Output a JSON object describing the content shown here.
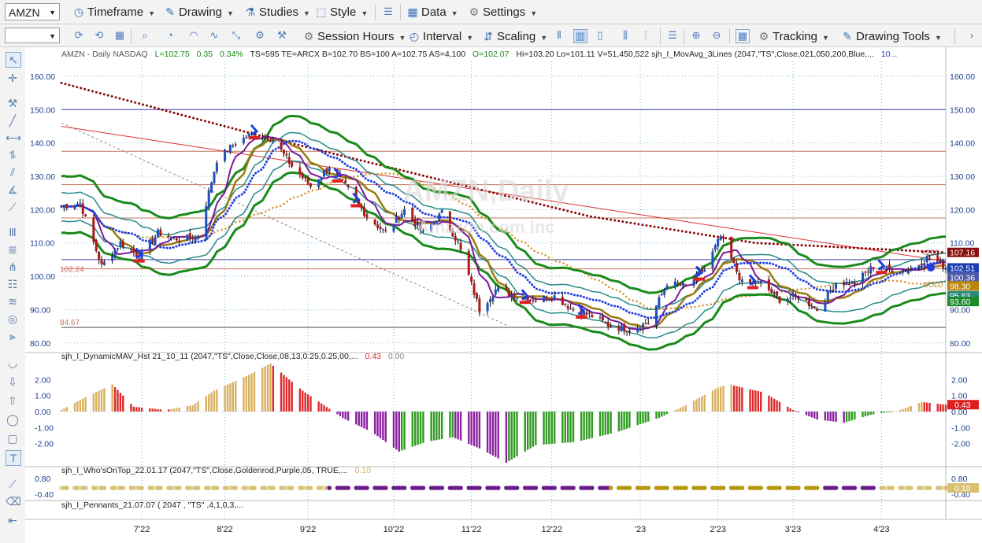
{
  "toolbar1": {
    "symbol": "AMZN",
    "items": [
      {
        "label": "Timeframe",
        "icon": "clock-icon"
      },
      {
        "label": "Drawing",
        "icon": "pencil-icon"
      },
      {
        "label": "Studies",
        "icon": "flask-icon"
      },
      {
        "label": "Style",
        "icon": "style-icon"
      },
      {
        "label": "Data",
        "icon": "data-icon"
      },
      {
        "label": "Settings",
        "icon": "gear-icon"
      }
    ]
  },
  "toolbar2": {
    "items": [
      {
        "label": "Session Hours",
        "icon": "gear-icon"
      },
      {
        "label": "Interval",
        "icon": "interval-icon"
      },
      {
        "label": "Scaling",
        "icon": "scaling-icon"
      },
      {
        "label": "Tracking",
        "icon": "tracking-icon"
      },
      {
        "label": "Drawing Tools",
        "icon": "drawing-tools-icon"
      }
    ]
  },
  "header": {
    "prefix": "AMZN - Daily  NASDAQ",
    "last": "L=102.75",
    "change": "0.35",
    "pct": "0.34%",
    "stats": "TS=595  TE=ARCX  B=102.70  BS=100  A=102.75  AS=4,100",
    "open": "O=102.07",
    "rest": "Hi=103.20  Lo=101.11  V=51,450,522  sjh_I_MovAvg_3Lines (2047,\"TS\",Close,021,050,200,Blue,...",
    "trail": "10..."
  },
  "watermark": {
    "line1": "AMZN,Daily",
    "line2": "Amazon.com Inc"
  },
  "chart_data": [
    {
      "type": "candlestick",
      "title": "AMZN - Daily  NASDAQ",
      "y_ticks": [
        "160.00",
        "150.00",
        "140.00",
        "130.00",
        "120.00",
        "110.00",
        "100.00",
        "90.00",
        "80.00"
      ],
      "ylim": [
        79,
        164
      ],
      "x_ticks": [
        "7'22",
        "8'22",
        "9'22",
        "10'22",
        "11'22",
        "12'22",
        "'23",
        "2'23",
        "3'23",
        "4'23"
      ],
      "x_domain": [
        "2022-06-01",
        "2023-04-27"
      ],
      "tick_dates": [
        "2022-07-01",
        "2022-08-01",
        "2022-09-01",
        "2022-10-03",
        "2022-11-01",
        "2022-12-01",
        "2023-01-03",
        "2023-02-01",
        "2023-03-01",
        "2023-04-03"
      ],
      "close_path": [
        {
          "d": "2022-06-01",
          "v": 121
        },
        {
          "d": "2022-06-08",
          "v": 122
        },
        {
          "d": "2022-06-16",
          "v": 103
        },
        {
          "d": "2022-06-23",
          "v": 110
        },
        {
          "d": "2022-06-30",
          "v": 106
        },
        {
          "d": "2022-07-07",
          "v": 113
        },
        {
          "d": "2022-07-15",
          "v": 111
        },
        {
          "d": "2022-07-22",
          "v": 112
        },
        {
          "d": "2022-07-29",
          "v": 135
        },
        {
          "d": "2022-08-05",
          "v": 140
        },
        {
          "d": "2022-08-12",
          "v": 143
        },
        {
          "d": "2022-08-19",
          "v": 141
        },
        {
          "d": "2022-08-26",
          "v": 133
        },
        {
          "d": "2022-09-02",
          "v": 127
        },
        {
          "d": "2022-09-09",
          "v": 133
        },
        {
          "d": "2022-09-16",
          "v": 126
        },
        {
          "d": "2022-09-23",
          "v": 118
        },
        {
          "d": "2022-09-30",
          "v": 113
        },
        {
          "d": "2022-10-07",
          "v": 120
        },
        {
          "d": "2022-10-14",
          "v": 113
        },
        {
          "d": "2022-10-21",
          "v": 119
        },
        {
          "d": "2022-10-27",
          "v": 110
        },
        {
          "d": "2022-11-04",
          "v": 90
        },
        {
          "d": "2022-11-10",
          "v": 96
        },
        {
          "d": "2022-11-18",
          "v": 94
        },
        {
          "d": "2022-11-25",
          "v": 93
        },
        {
          "d": "2022-12-02",
          "v": 94
        },
        {
          "d": "2022-12-09",
          "v": 90
        },
        {
          "d": "2022-12-16",
          "v": 88
        },
        {
          "d": "2022-12-23",
          "v": 85
        },
        {
          "d": "2022-12-30",
          "v": 84
        },
        {
          "d": "2023-01-06",
          "v": 86
        },
        {
          "d": "2023-01-13",
          "v": 98
        },
        {
          "d": "2023-01-20",
          "v": 97
        },
        {
          "d": "2023-01-27",
          "v": 102
        },
        {
          "d": "2023-02-02",
          "v": 112
        },
        {
          "d": "2023-02-10",
          "v": 98
        },
        {
          "d": "2023-02-17",
          "v": 98
        },
        {
          "d": "2023-02-24",
          "v": 93
        },
        {
          "d": "2023-03-03",
          "v": 94
        },
        {
          "d": "2023-03-10",
          "v": 90
        },
        {
          "d": "2023-03-17",
          "v": 98
        },
        {
          "d": "2023-03-24",
          "v": 98
        },
        {
          "d": "2023-03-31",
          "v": 103
        },
        {
          "d": "2023-04-07",
          "v": 102
        },
        {
          "d": "2023-04-14",
          "v": 102
        },
        {
          "d": "2023-04-21",
          "v": 106
        },
        {
          "d": "2023-04-27",
          "v": 102.75
        }
      ],
      "ma200": [
        {
          "d": "2022-06-01",
          "v": 158
        },
        {
          "d": "2022-08-15",
          "v": 142
        },
        {
          "d": "2022-10-15",
          "v": 130
        },
        {
          "d": "2022-12-15",
          "v": 118
        },
        {
          "d": "2023-02-15",
          "v": 110
        },
        {
          "d": "2023-04-27",
          "v": 107.16
        }
      ],
      "horizontal_levels": [
        {
          "v": 150,
          "color": "#3b3ba8"
        },
        {
          "v": 137.5,
          "color": "#c07a5a"
        },
        {
          "v": 127.5,
          "color": "#c07a5a"
        },
        {
          "v": 117.5,
          "color": "#c07a5a"
        },
        {
          "v": 105,
          "color": "#3b3ba8"
        },
        {
          "v": 102.24,
          "color": "#d07060"
        },
        {
          "v": 84.67,
          "color": "#444444"
        }
      ],
      "level_labels": [
        "102.24",
        "84.67"
      ],
      "right_badges": [
        {
          "text": "107.16",
          "v": 107.16,
          "bg": "#8b0e0e"
        },
        {
          "text": "102.51",
          "v": 102.51,
          "bg": "#1f3fb0"
        },
        {
          "text": "100.36",
          "v": 100.36,
          "bg": "#4e5aa8"
        },
        {
          "text": "98.30",
          "v": 98.3,
          "bg": "#b8860b"
        },
        {
          "text": "95.83",
          "v": 95.83,
          "bg": "#2a8a7a"
        },
        {
          "text": "93.60",
          "v": 93.6,
          "bg": "#1a8a2a"
        }
      ],
      "ma200_tag": "<200",
      "gold_tag": "GOLD"
    },
    {
      "type": "bar",
      "title": "sjh_I_DynamicMAV_Hst 21_10_11 (2047,\"TS\",Close,Close,08,13,0.25,0.25,00,...",
      "last_value": "0.43",
      "extra_value": "0.00",
      "y_ticks": [
        "2.00",
        "1.00",
        "0.00",
        "-1.00",
        "-2.00"
      ],
      "ylim": [
        -3.2,
        3.0
      ],
      "bar_path": [
        {
          "d": "2022-06-01",
          "v": 0.1
        },
        {
          "d": "2022-06-10",
          "v": 0.9
        },
        {
          "d": "2022-06-20",
          "v": 1.7
        },
        {
          "d": "2022-06-28",
          "v": 0.3
        },
        {
          "d": "2022-07-10",
          "v": 0.1
        },
        {
          "d": "2022-07-20",
          "v": 0.4
        },
        {
          "d": "2022-07-28",
          "v": 1.3
        },
        {
          "d": "2022-08-10",
          "v": 2.3
        },
        {
          "d": "2022-08-18",
          "v": 3.0
        },
        {
          "d": "2022-08-30",
          "v": 1.3
        },
        {
          "d": "2022-09-07",
          "v": 0.4
        },
        {
          "d": "2022-09-14",
          "v": -0.4
        },
        {
          "d": "2022-09-25",
          "v": -1.3
        },
        {
          "d": "2022-10-05",
          "v": -2.5
        },
        {
          "d": "2022-10-15",
          "v": -1.9
        },
        {
          "d": "2022-10-25",
          "v": -1.6
        },
        {
          "d": "2022-11-04",
          "v": -2.3
        },
        {
          "d": "2022-11-14",
          "v": -3.2
        },
        {
          "d": "2022-11-25",
          "v": -2.1
        },
        {
          "d": "2022-12-10",
          "v": -1.9
        },
        {
          "d": "2022-12-25",
          "v": -1.3
        },
        {
          "d": "2023-01-10",
          "v": -0.4
        },
        {
          "d": "2023-01-20",
          "v": 0.4
        },
        {
          "d": "2023-02-01",
          "v": 1.5
        },
        {
          "d": "2023-02-05",
          "v": 1.7
        },
        {
          "d": "2023-02-18",
          "v": 1.2
        },
        {
          "d": "2023-03-01",
          "v": 0.1
        },
        {
          "d": "2023-03-10",
          "v": -0.5
        },
        {
          "d": "2023-03-20",
          "v": -0.7
        },
        {
          "d": "2023-03-30",
          "v": -0.2
        },
        {
          "d": "2023-04-10",
          "v": 0.1
        },
        {
          "d": "2023-04-18",
          "v": 0.6
        },
        {
          "d": "2023-04-27",
          "v": 0.43
        }
      ],
      "colors": {
        "pos_up": "#d8b060",
        "pos_down": "#e02828",
        "neg_down": "#8a1fa0",
        "neg_up": "#2e9a1e"
      }
    },
    {
      "type": "heatmap",
      "title": "sjh_I_Who'sOnTop_22.01.17 (2047,\"TS\",Close,Goldenrod,Purple,05, TRUE,...",
      "last_value": "0.10",
      "y_ticks": [
        "0.80",
        "-0.40"
      ],
      "dot_colors": [
        "#d8c070",
        "#b8960a",
        "#6a1a8a",
        "#e0d8a0"
      ]
    },
    {
      "type": "table",
      "title": "sjh_I_Pennants_21.07.07 ( 2047 , \"TS\" ,4,1,0,3,..."
    }
  ]
}
